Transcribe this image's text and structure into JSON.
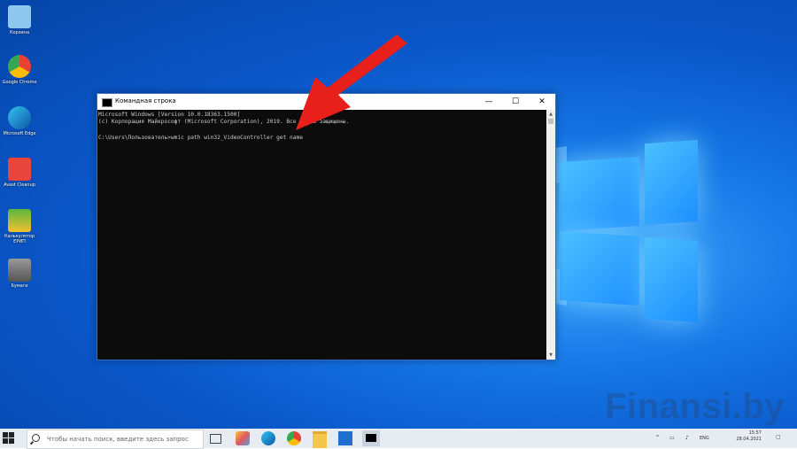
{
  "desktop_icons": [
    {
      "label": "Корзина",
      "color": "#6fb7e8",
      "icon": "recycle-bin-icon"
    },
    {
      "label": "Google Chrome",
      "color": "#e94235",
      "icon": "chrome-icon"
    },
    {
      "label": "Microsoft Edge",
      "color": "#1e9be0",
      "icon": "edge-icon"
    },
    {
      "label": "Avast Cleanup",
      "color": "#e8453c",
      "icon": "avast-icon"
    },
    {
      "label": "Калькулятор ЕРИП",
      "color": "#59b640",
      "icon": "calculator-icon"
    },
    {
      "label": "Бумаги",
      "color": "#777777",
      "icon": "app-icon"
    }
  ],
  "cmd": {
    "title": "Командная строка",
    "minimize": "—",
    "maximize": "☐",
    "close": "✕",
    "lines": [
      "Microsoft Windows [Version 10.0.18363.1500]",
      "(c) Корпорация Майкрософт (Microsoft Corporation), 2019. Все права защищены.",
      "",
      "C:\\Users\\Пользователь>wmic path win32_VideoController get name"
    ]
  },
  "watermark": "Finansi.by",
  "taskbar": {
    "search_placeholder": "Чтобы начать поиск, введите здесь запрос",
    "clock_time": "15:57",
    "clock_date": "28.04.2021",
    "language": "ENG",
    "apps": [
      "task-view-icon",
      "paint-icon",
      "edge-icon",
      "chrome-icon",
      "file-explorer-icon",
      "store-icon",
      "cmd-icon"
    ]
  },
  "colors": {
    "desktop": "#0a57c9",
    "arrow": "#e8201b",
    "console_bg": "#0c0c0c",
    "console_text": "#cccccc"
  }
}
